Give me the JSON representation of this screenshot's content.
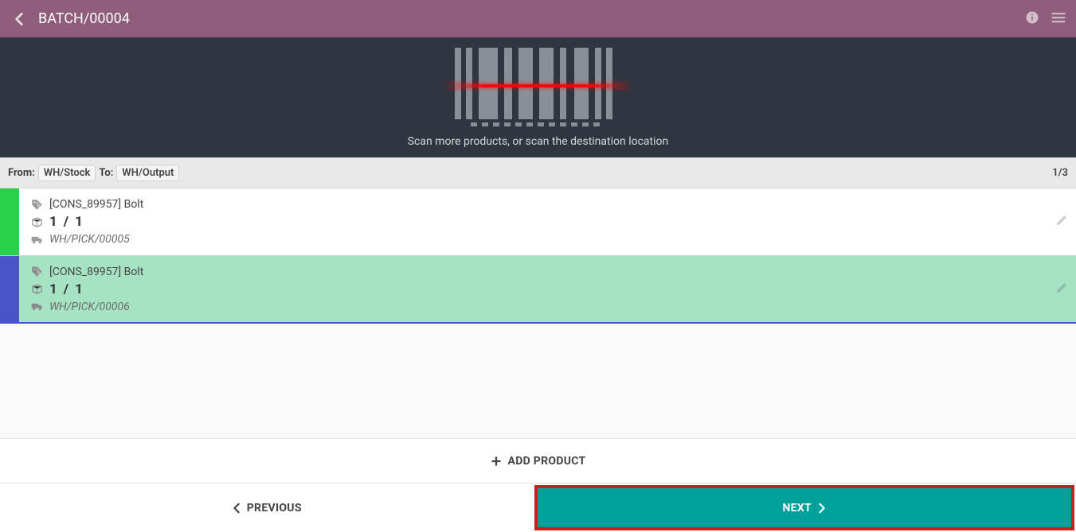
{
  "header": {
    "title": "BATCH/00004"
  },
  "scan": {
    "message": "Scan more products, or scan the destination location"
  },
  "locations": {
    "from_label": "From:",
    "from_value": "WH/Stock",
    "to_label": "To:",
    "to_value": "WH/Output",
    "count": "1/3"
  },
  "lines": [
    {
      "product": "[CONS_89957] Bolt",
      "qty_done": "1",
      "qty_total": "1",
      "source": "WH/PICK/00005",
      "stripe_color": "#29d14a",
      "body_bg": "#ffffff"
    },
    {
      "product": "[CONS_89957] Bolt",
      "qty_done": "1",
      "qty_total": "1",
      "source": "WH/PICK/00006",
      "stripe_color": "#4a54c9",
      "body_bg": "#a6e2c4"
    }
  ],
  "actions": {
    "add_product": "ADD PRODUCT",
    "previous": "PREVIOUS",
    "next": "NEXT"
  },
  "icons": {
    "back": "chevron-left",
    "info": "info",
    "menu": "menu",
    "tag": "tag",
    "box": "box",
    "truck": "truck",
    "edit": "pencil",
    "plus": "plus",
    "chevron_right": "chevron-right",
    "chevron_left_small": "chevron-left"
  }
}
